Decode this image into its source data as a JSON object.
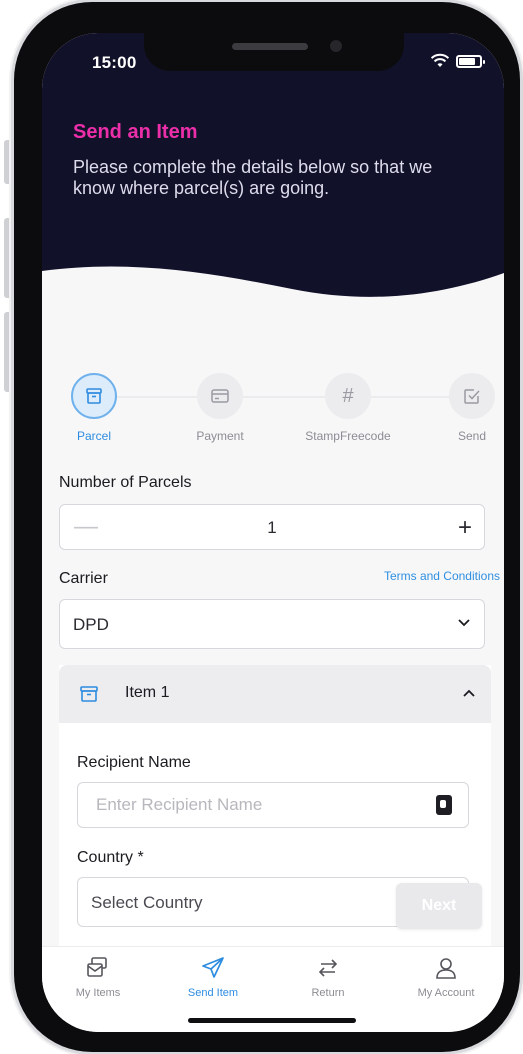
{
  "status_bar": {
    "time": "15:00"
  },
  "header": {
    "title": "Send an Item",
    "subtitle": "Please complete the details below so that we know where parcel(s) are going."
  },
  "steps": [
    {
      "label": "Parcel",
      "icon": "box-icon",
      "active": true
    },
    {
      "label": "Payment",
      "icon": "card-icon",
      "active": false
    },
    {
      "label": "StampFreecode",
      "icon": "hash-icon",
      "glyph": "#",
      "active": false
    },
    {
      "label": "Send",
      "icon": "check-square-icon",
      "active": false
    }
  ],
  "parcels": {
    "label": "Number of Parcels",
    "minus": "—",
    "plus": "+",
    "value": "1"
  },
  "carrier": {
    "label": "Carrier",
    "terms_link": "Terms and Conditions",
    "selected": "DPD"
  },
  "item": {
    "title": "Item 1",
    "recipient_label": "Recipient Name",
    "recipient_placeholder": "Enter Recipient Name",
    "country_label": "Country *",
    "country_placeholder": "Select Country"
  },
  "next_label": "Next",
  "tabs": [
    {
      "label": "My Items",
      "icon": "items-icon",
      "active": false
    },
    {
      "label": "Send Item",
      "icon": "send-icon",
      "active": true
    },
    {
      "label": "Return",
      "icon": "return-icon",
      "active": false
    },
    {
      "label": "My Account",
      "icon": "account-icon",
      "active": false
    }
  ],
  "colors": {
    "header_bg": "#12112a",
    "accent_pink": "#ec2fa9",
    "accent_blue": "#2e8ce0"
  }
}
